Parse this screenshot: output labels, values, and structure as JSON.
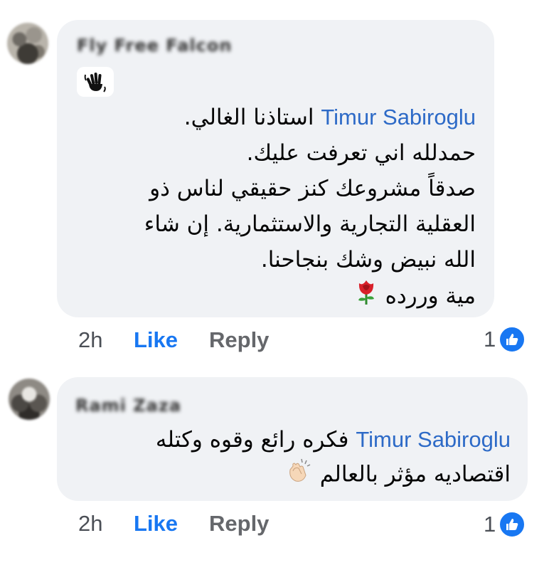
{
  "comments": [
    {
      "author": "Fly Free Falcon",
      "badge_icon": "waving-hand-icon",
      "mention": "Timur Sabiroglu",
      "first_line_after_mention": "استاذنا الغالي.",
      "lines": [
        "حمدلله اني تعرفت عليك.",
        "صدقاً مشروعك كنز حقيقي لناس ذو",
        "العقلية التجارية والاستثمارية. إن شاء",
        "الله نبيض وشك بنجاحنا.",
        "مية وررده"
      ],
      "trailing_emoji": "rose-icon",
      "time": "2h",
      "like_label": "Like",
      "reply_label": "Reply",
      "reaction_count": "1"
    },
    {
      "author": "Rami Zaza",
      "mention": "Timur Sabiroglu",
      "first_line_after_mention": "فكره رائع وقوه وكتله",
      "lines": [
        "اقتصاديه مؤثر بالعالم"
      ],
      "trailing_emoji": "clapping-hands-icon",
      "time": "2h",
      "like_label": "Like",
      "reply_label": "Reply",
      "reaction_count": "1"
    }
  ],
  "colors": {
    "bubble": "#f0f2f5",
    "mention": "#2d6ac7",
    "like": "#1877f2",
    "muted": "#65676b"
  }
}
